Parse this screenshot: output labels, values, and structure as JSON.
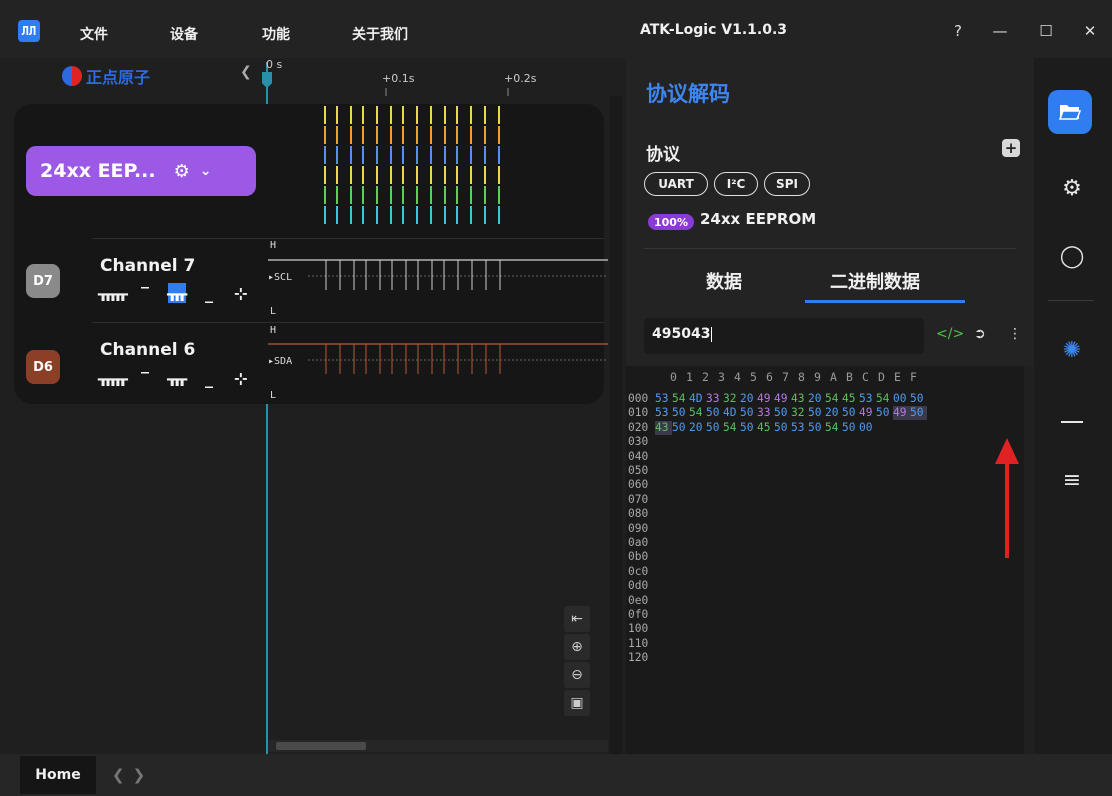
{
  "app": {
    "logo_text": "ЛЛ",
    "title": "ATK-Logic V1.1.0.3",
    "menu": [
      "文件",
      "设备",
      "功能",
      "关于我们"
    ],
    "window_controls": [
      "?",
      "—",
      "☐",
      "✕"
    ],
    "brand": "正点原子"
  },
  "timeline": {
    "ticks": [
      "0 s",
      "+0.1s",
      "+0.2s"
    ]
  },
  "decoder": {
    "label": "24xx EEP...",
    "gear_icon": "gear-icon",
    "chevron_icon": "chevron-down-icon"
  },
  "channels": [
    {
      "badge": "D7",
      "name": "Channel 7",
      "color": "#8a8a8a",
      "signal": "SCL",
      "wave_color": "#cfcfcf",
      "triggers": [
        "rising-edge",
        "high",
        "falling-edge",
        "low",
        "any-edge"
      ],
      "active_trigger": 2
    },
    {
      "badge": "D6",
      "name": "Channel 6",
      "color": "#8a3f26",
      "signal": "SDA",
      "wave_color": "#b85a3a",
      "triggers": [
        "rising-edge",
        "high",
        "falling-edge",
        "low",
        "any-edge"
      ],
      "active_trigger": -1
    }
  ],
  "wave_levels": {
    "high": "H",
    "low": "L"
  },
  "overview_colors": [
    "#e8d84a",
    "#f0a030",
    "#5a8ff0",
    "#e8d84a",
    "#5ad05a",
    "#3ac8d8"
  ],
  "zoom_tools": [
    "fit-start-icon",
    "zoom-in-icon",
    "zoom-out-icon",
    "fit-all-icon"
  ],
  "protocol_panel": {
    "title": "协议解码",
    "section_label": "协议",
    "chips": [
      "UART",
      "I²C",
      "SPI"
    ],
    "progress": "100%",
    "protocol_name": "24xx EEPROM",
    "tabs": [
      "数据",
      "二进制数据"
    ],
    "active_tab": 1,
    "search_value": "495043",
    "hex_header": [
      "0",
      "1",
      "2",
      "3",
      "4",
      "5",
      "6",
      "7",
      "8",
      "9",
      "A",
      "B",
      "C",
      "D",
      "E",
      "F"
    ],
    "hex_rows": [
      {
        "addr": "000",
        "bytes": [
          "53",
          "54",
          "4D",
          "33",
          "32",
          "20",
          "49",
          "49",
          "43",
          "20",
          "54",
          "45",
          "53",
          "54",
          "00",
          "50"
        ]
      },
      {
        "addr": "010",
        "bytes": [
          "53",
          "50",
          "54",
          "50",
          "4D",
          "50",
          "33",
          "50",
          "32",
          "50",
          "20",
          "50",
          "49",
          "50",
          "49",
          "50"
        ]
      },
      {
        "addr": "020",
        "bytes": [
          "43",
          "50",
          "20",
          "50",
          "54",
          "50",
          "45",
          "50",
          "53",
          "50",
          "54",
          "50",
          "00"
        ]
      },
      {
        "addr": "030",
        "bytes": []
      },
      {
        "addr": "040",
        "bytes": []
      },
      {
        "addr": "050",
        "bytes": []
      },
      {
        "addr": "060",
        "bytes": []
      },
      {
        "addr": "070",
        "bytes": []
      },
      {
        "addr": "080",
        "bytes": []
      },
      {
        "addr": "090",
        "bytes": []
      },
      {
        "addr": "0a0",
        "bytes": []
      },
      {
        "addr": "0b0",
        "bytes": []
      },
      {
        "addr": "0c0",
        "bytes": []
      },
      {
        "addr": "0d0",
        "bytes": []
      },
      {
        "addr": "0e0",
        "bytes": []
      },
      {
        "addr": "0f0",
        "bytes": []
      },
      {
        "addr": "100",
        "bytes": []
      },
      {
        "addr": "110",
        "bytes": []
      },
      {
        "addr": "120",
        "bytes": []
      }
    ],
    "byte_colors": {
      "53": "#4f9bf0",
      "54": "#5fbf5f",
      "4D": "#4f9bf0",
      "33": "#b57ae0",
      "32": "#5fbf5f",
      "20": "#4f9bf0",
      "49": "#b57ae0",
      "43": "#5fbf5f",
      "45": "#5fbf5f",
      "00": "#4f9bf0",
      "50": "#4f9bf0"
    },
    "icons": [
      "code-icon",
      "export-icon",
      "more-icon"
    ]
  },
  "toolbar": [
    "folder-icon",
    "settings-icon",
    "search-wave-icon",
    "wave-icon",
    "ruler-icon",
    "list-search-icon"
  ],
  "status": {
    "home_tab": "Home"
  }
}
